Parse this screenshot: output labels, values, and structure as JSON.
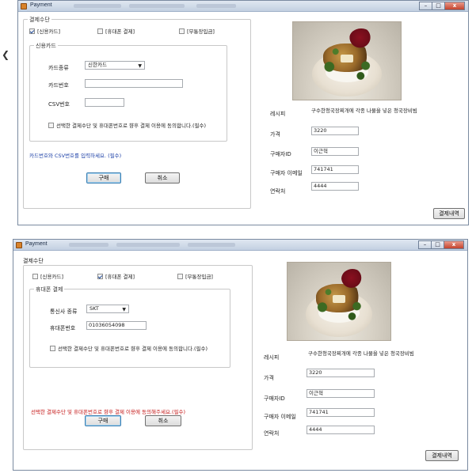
{
  "screens": [
    {
      "title": "Payment",
      "close_glyph": "x",
      "payment_method_label": "결제수단",
      "methods": [
        {
          "label": "[신용카드]",
          "checked": true
        },
        {
          "label": "[휴대폰 결제]",
          "checked": false
        },
        {
          "label": "[무통장입금]",
          "checked": false
        }
      ],
      "group_title": "신용카드",
      "fields": {
        "card_type_label": "카드종류",
        "card_type_value": "신한카드",
        "card_number_label": "카드번호",
        "card_number_value": "",
        "csv_label": "CSV번호",
        "csv_value": ""
      },
      "consent_label": "선택한 결제수단 및 휴대폰번호로 향후 결제 이용에 동의합니다.(필수)",
      "consent_checked": false,
      "notice": "카드번호와 CSV번호를 입력하세요. (필수)",
      "notice_color": "#1a3ea6",
      "buy_label": "구매",
      "cancel_label": "취소",
      "recipe_label": "레시피",
      "recipe_value": "구수한청국장찌개에 각종 나물을 넣은 청국장비빔",
      "price_label": "가격",
      "price_value": "3220",
      "buyer_id_label": "구매자ID",
      "buyer_id_value": "이근혁",
      "buyer_email_label": "구매자 이메일",
      "buyer_email_value": "741741",
      "contact_label": "연락처",
      "contact_value": "4444",
      "history_label": "결제내역"
    },
    {
      "title": "Payment",
      "close_glyph": "x",
      "payment_method_label": "결제수단",
      "methods": [
        {
          "label": "[신용카드]",
          "checked": false
        },
        {
          "label": "[휴대폰 결제]",
          "checked": true
        },
        {
          "label": "[무통장입금]",
          "checked": false
        }
      ],
      "group_title": "휴대폰 결제",
      "fields": {
        "carrier_label": "통신사 종류",
        "carrier_value": "SKT",
        "phone_label": "휴대폰번호",
        "phone_value": "01036054098"
      },
      "consent_label": "선택한 결제수단 및 휴대폰번호로 향후 결제 이용에 동의합니다.(필수)",
      "consent_checked": false,
      "notice": "선택한 결제수단 및 휴대폰번호로 향후 결제 이용에 동의해주세요.(필수)",
      "notice_color": "#c41616",
      "buy_label": "구매",
      "cancel_label": "취소",
      "recipe_label": "레시피",
      "recipe_value": "구수한청국장찌개에 각종 나물을 넣은 청국장비빔",
      "price_label": "가격",
      "price_value": "3220",
      "buyer_id_label": "구매자ID",
      "buyer_id_value": "이근혁",
      "buyer_email_label": "구매자 이메일",
      "buyer_email_value": "741741",
      "contact_label": "연락처",
      "contact_value": "4444",
      "history_label": "결제내역"
    }
  ],
  "icons": {
    "app": "payment-app-icon",
    "checkbox_checked": "check-icon",
    "dropdown": "chevron-down-icon",
    "arrow": "arrow-left-icon",
    "minimize": "minimize-icon",
    "maximize": "maximize-icon",
    "close": "close-icon"
  }
}
